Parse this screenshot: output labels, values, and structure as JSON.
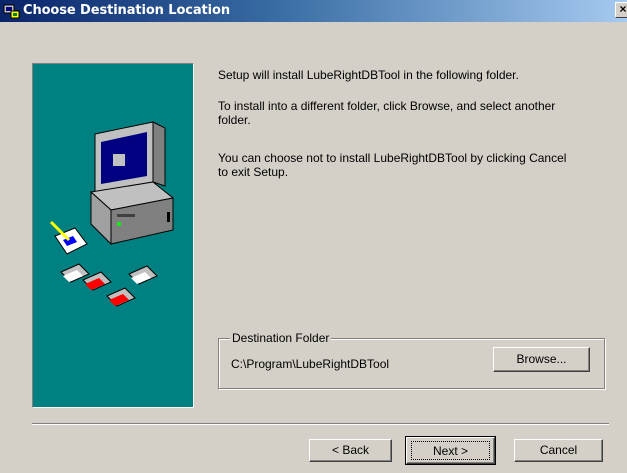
{
  "window": {
    "title": "Choose Destination Location",
    "close_glyph": "×"
  },
  "messages": {
    "line1": "Setup will install LubeRightDBTool in the following folder.",
    "line2": "To install into a different folder, click Browse, and select another folder.",
    "line3": "You can choose not to install LubeRightDBTool by clicking Cancel to exit Setup."
  },
  "destination": {
    "group_label": "Destination Folder",
    "path": "C:\\Program\\LubeRightDBTool",
    "browse_label": "Browse..."
  },
  "buttons": {
    "back_label": "< Back",
    "next_label": "Next >",
    "cancel_label": "Cancel"
  },
  "colors": {
    "bitmap_bg": "#008080",
    "titlebar": "#0a246a",
    "dialog_bg": "#d4d0c8"
  }
}
